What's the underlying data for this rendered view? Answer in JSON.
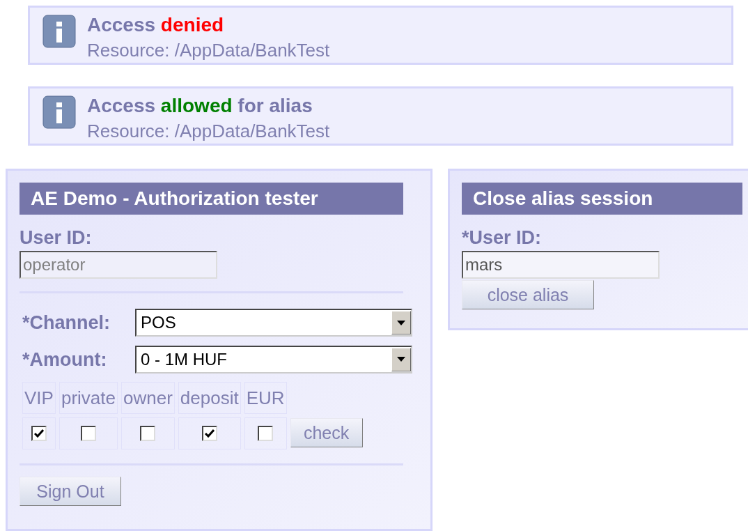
{
  "messages": [
    {
      "title_parts": [
        {
          "text": "Access",
          "color": "#7777aa"
        },
        {
          "text": "denied",
          "color": "#ff0000"
        }
      ],
      "resource": "Resource: /AppData/BankTest"
    },
    {
      "title_parts": [
        {
          "text": "Access",
          "color": "#7777aa"
        },
        {
          "text": "allowed",
          "color": "#008000"
        },
        {
          "text": "for alias",
          "color": "#7777aa"
        }
      ],
      "resource": "Resource: /AppData/BankTest"
    }
  ],
  "tester": {
    "title": "AE Demo - Authorization tester",
    "user_id": {
      "label": "User ID:",
      "value": "operator",
      "disabled": true
    },
    "selects": [
      {
        "label": "*Channel:",
        "value": "POS"
      },
      {
        "label": "*Amount:",
        "value": "0 - 1M HUF"
      }
    ],
    "flags": [
      {
        "label": "VIP",
        "checked": true
      },
      {
        "label": "private",
        "checked": false
      },
      {
        "label": "owner",
        "checked": false
      },
      {
        "label": "deposit",
        "checked": true
      },
      {
        "label": "EUR",
        "checked": false
      }
    ],
    "check_button": "check",
    "sign_out_button": "Sign Out"
  },
  "alias": {
    "title": "Close alias session",
    "user_id": {
      "label": "*User ID:",
      "value": "mars",
      "disabled": false
    },
    "close_button": "close alias"
  }
}
